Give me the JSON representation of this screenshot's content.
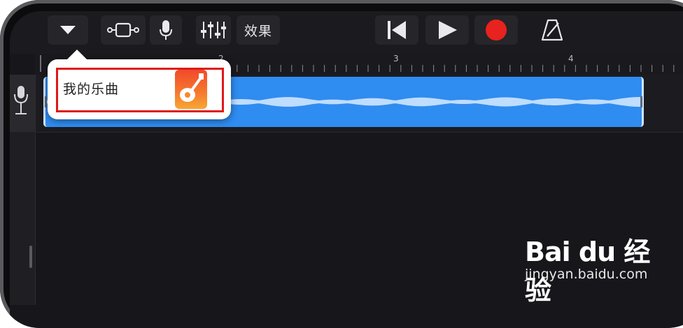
{
  "toolbar": {
    "effects_label": "效果",
    "buttons": [
      "tracks-menu-icon",
      "track-view-icon",
      "microphone-icon",
      "mixer-icon",
      "rewind-icon",
      "play-icon",
      "record-icon",
      "metronome-icon"
    ],
    "record_color": "#e8221f"
  },
  "ruler": {
    "markers": [
      "2",
      "3",
      "4"
    ]
  },
  "popup": {
    "song_title": "我的乐曲",
    "icon": "garageband-guitar-icon",
    "highlight_color": "#e01818"
  },
  "region": {
    "color": "#2f8cf0"
  },
  "watermark": {
    "logo_text": "Bai du 经验",
    "url": "jingyan.baidu.com"
  }
}
